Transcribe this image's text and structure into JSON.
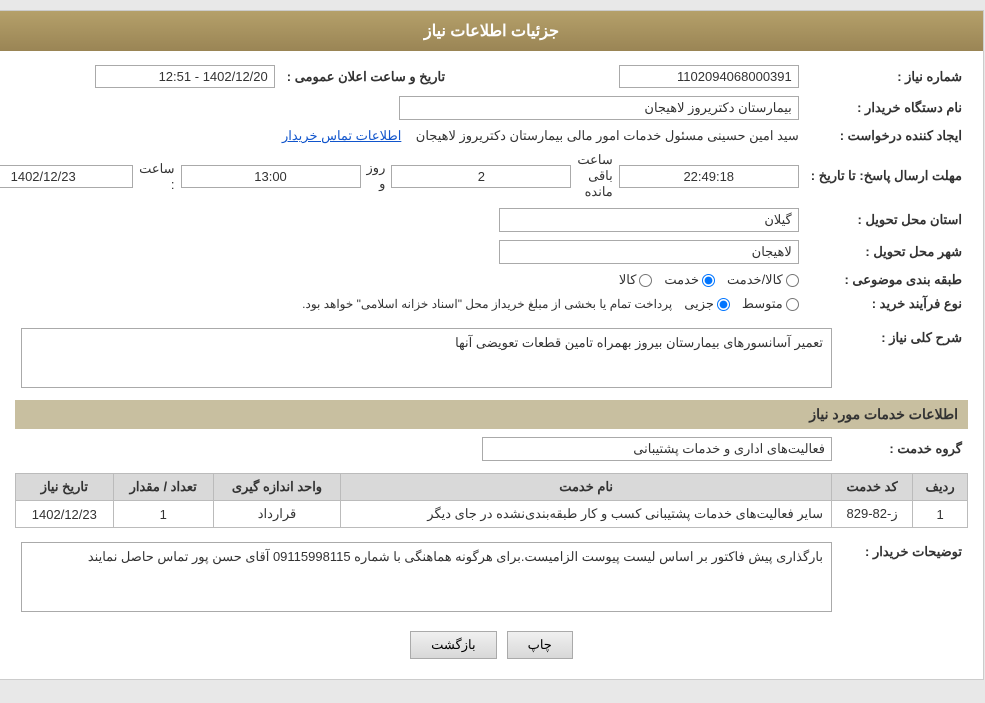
{
  "header": {
    "title": "جزئیات اطلاعات نیاز"
  },
  "fields": {
    "shomara_niaz_label": "شماره نیاز :",
    "shomara_niaz_value": "1102094068000391",
    "nam_dastgah_label": "نام دستگاه خریدار :",
    "nam_dastgah_value": "بیمارستان دکتریروز لاهیجان",
    "tarikh_label": "تاریخ و ساعت اعلان عمومی :",
    "tarikh_value": "1402/12/20 - 12:51",
    "ijad_label": "ایجاد کننده درخواست :",
    "ijad_value": "سید امین حسینی مسئول خدمات امور مالی بیمارستان دکتریروز لاهیجان",
    "ijad_link": "اطلاعات تماس خریدار",
    "mohlat_label": "مهلت ارسال پاسخ: تا تاریخ :",
    "mohlat_date": "1402/12/23",
    "mohlat_saaat_label": "ساعت :",
    "mohlat_saat": "13:00",
    "mohlat_roz_label": "روز و",
    "mohlat_roz": "2",
    "mohlat_baqi_label": "ساعت باقی مانده",
    "mohlat_baqi": "22:49:18",
    "ostan_label": "استان محل تحویل :",
    "ostan_value": "گیلان",
    "shahr_label": "شهر محل تحویل :",
    "shahr_value": "لاهیجان",
    "tabaghe_label": "طبقه بندی موضوعی :",
    "tabaghe_options": [
      "کالا",
      "خدمت",
      "کالا/خدمت"
    ],
    "tabaghe_selected": "خدمت",
    "nooe_label": "نوع فرآیند خرید :",
    "nooe_options": [
      "جزیی",
      "متوسط"
    ],
    "nooe_note": "پرداخت تمام یا بخشی از مبلغ خریداز محل \"اسناد خزانه اسلامی\" خواهد بود.",
    "sharh_label": "شرح کلی نیاز :",
    "sharh_value": "تعمیر آسانسورهای بیمارستان بیروز بهمراه تامین قطعات تعویضی آنها",
    "khadamat_header": "اطلاعات خدمات مورد نیاز",
    "gorooh_label": "گروه خدمت :",
    "gorooh_value": "فعالیت‌های اداری و خدمات پشتیبانی",
    "table": {
      "headers": [
        "ردیف",
        "کد خدمت",
        "نام خدمت",
        "واحد اندازه گیری",
        "تعداد / مقدار",
        "تاریخ نیاز"
      ],
      "rows": [
        {
          "radif": "1",
          "kod": "ز-82-829",
          "nam": "سایر فعالیت‌های خدمات پشتیبانی کسب و کار طبقه‌بندی‌نشده در جای دیگر",
          "vahed": "قرارداد",
          "tedad": "1",
          "tarikh": "1402/12/23"
        }
      ]
    },
    "tozihat_label": "توضیحات خریدار :",
    "tozihat_value": "بارگذاری پیش فاکتور بر اساس لیست پیوست الزامیست.برای هرگونه هماهنگی با شماره 09115998115 آقای حسن پور تماس حاصل نمایند"
  },
  "buttons": {
    "print": "چاپ",
    "back": "بازگشت"
  }
}
